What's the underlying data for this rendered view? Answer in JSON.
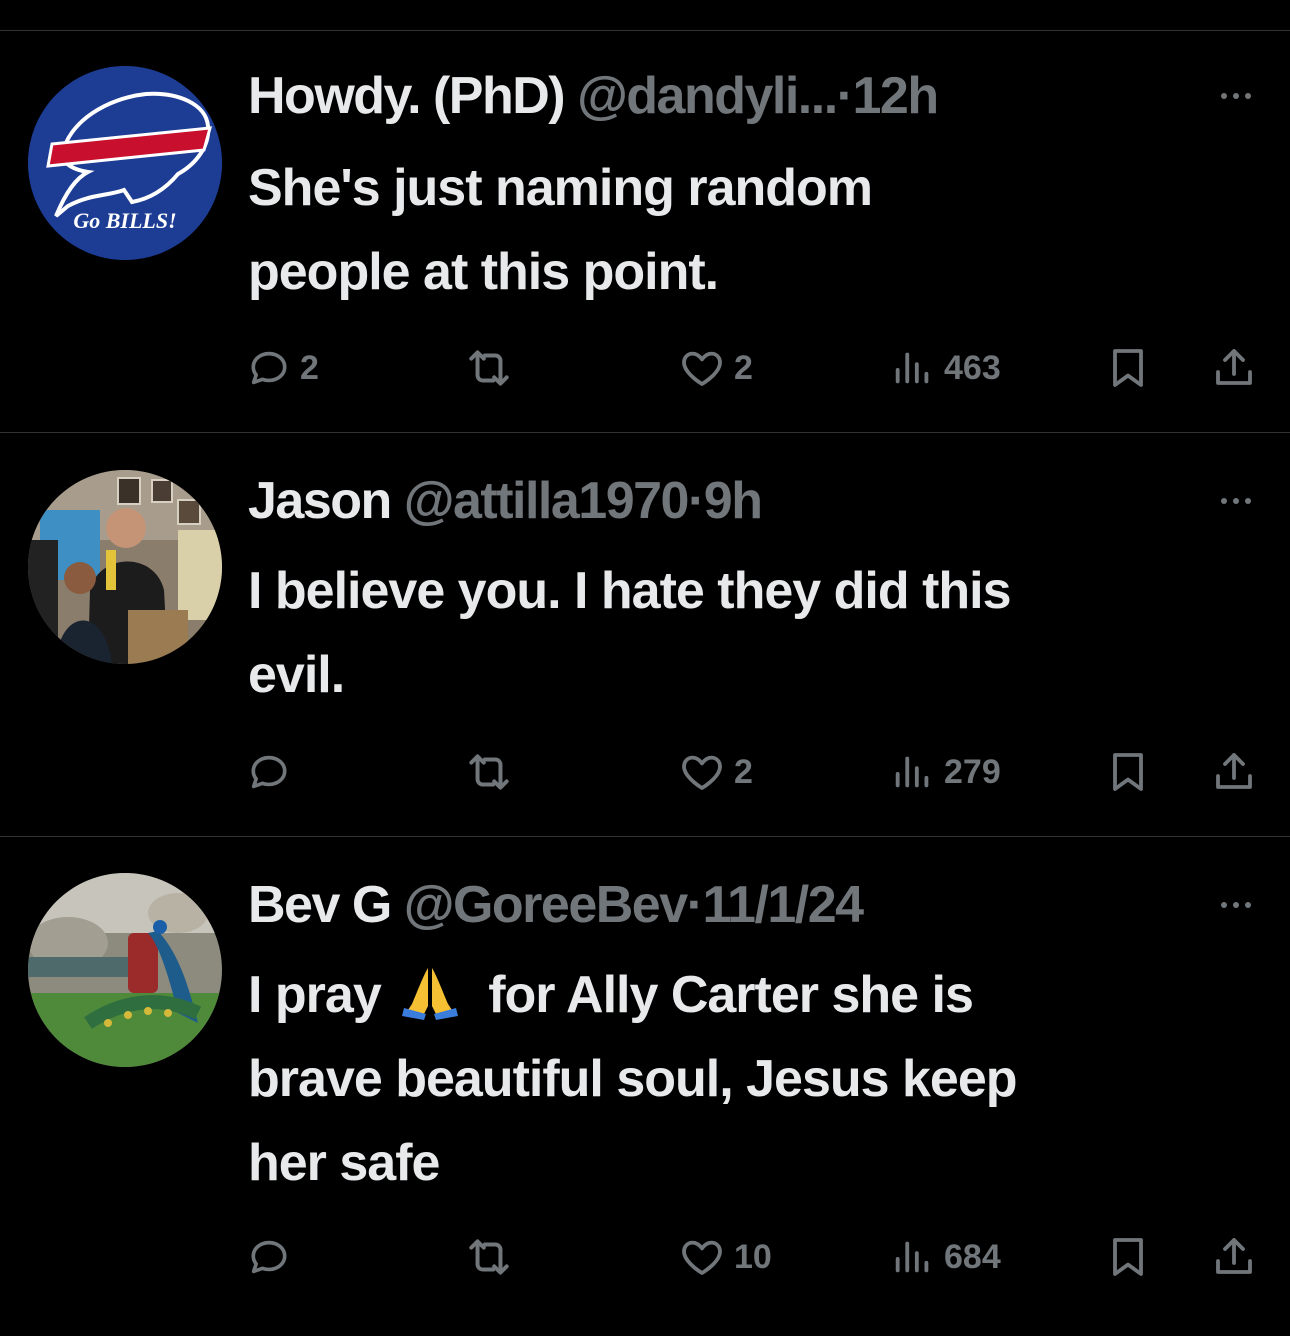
{
  "tweets": [
    {
      "name": "Howdy. (PhD)",
      "handle": "@dandyli...",
      "separator": "·",
      "time": "12h",
      "text_lines": [
        "She's just naming random",
        "people at this point."
      ],
      "avatar_text": "Go BILLS!",
      "replies": "2",
      "reposts": "",
      "likes": "2",
      "views": "463"
    },
    {
      "name": "Jason",
      "handle": "@attilla1970",
      "separator": "·",
      "time": "9h",
      "text_lines": [
        "I believe you. I hate they did this",
        "evil."
      ],
      "replies": "",
      "reposts": "",
      "likes": "2",
      "views": "279"
    },
    {
      "name": "Bev G",
      "handle": "@GoreeBev",
      "separator": "·",
      "time": "11/1/24",
      "text_line1_before": "I pray",
      "text_emoji": "folded-hands-emoji",
      "text_line1_after": "for Ally Carter she is",
      "text_lines_rest": [
        "brave beautiful soul, Jesus keep",
        "her safe"
      ],
      "replies": "",
      "reposts": "",
      "likes": "10",
      "views": "684"
    }
  ],
  "colors": {
    "background": "#000000",
    "primary_text": "#e7e9ea",
    "secondary_text": "#71767b",
    "divider": "#2f3336",
    "bills_blue": "#1d3c93",
    "bills_red": "#c8102e"
  }
}
